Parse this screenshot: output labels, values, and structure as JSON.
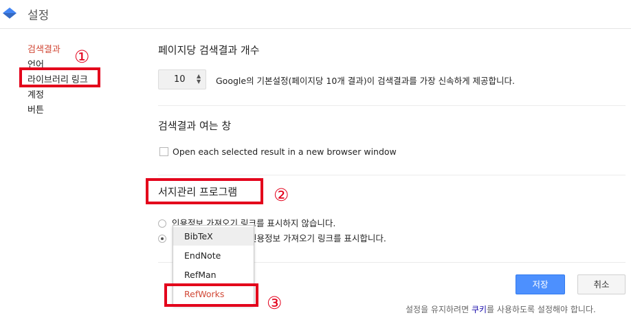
{
  "header": {
    "title": "설정"
  },
  "colors": {
    "accent_red": "#d14836",
    "annotation_red": "#e3001b",
    "primary_blue": "#4d90fe",
    "link_blue": "#1a0dab"
  },
  "sidebar": {
    "items": [
      {
        "label": "검색결과",
        "active": true
      },
      {
        "label": "언어"
      },
      {
        "label": "라이브러리 링크"
      },
      {
        "label": "계정"
      },
      {
        "label": "버튼"
      }
    ]
  },
  "results_per_page": {
    "title": "페이지당 검색결과 개수",
    "value": "10",
    "description": "Google의 기본설정(페이지당 10개 결과)이 검색결과를 가장 신속하게 제공합니다."
  },
  "open_window": {
    "title": "검색결과 여는 창",
    "checkbox_label": "Open each selected result in a new browser window"
  },
  "bib_manager": {
    "title": "서지관리 프로그램",
    "option_none": "인용정보 가져오기 링크를 표시하지 않습니다.",
    "option_show_suffix": "인용정보 가져오기 링크를 표시합니다.",
    "dropdown_options": [
      "BibTeX",
      "EndNote",
      "RefMan",
      "RefWorks"
    ]
  },
  "buttons": {
    "save": "저장",
    "cancel": "취소"
  },
  "footer": {
    "note_before": "설정을 유지하려면 ",
    "cookie_link": "쿠키",
    "note_after": "를 사용하도록 설정해야 합니다."
  },
  "annotations": {
    "n1": "①",
    "n2": "②",
    "n3": "③"
  }
}
